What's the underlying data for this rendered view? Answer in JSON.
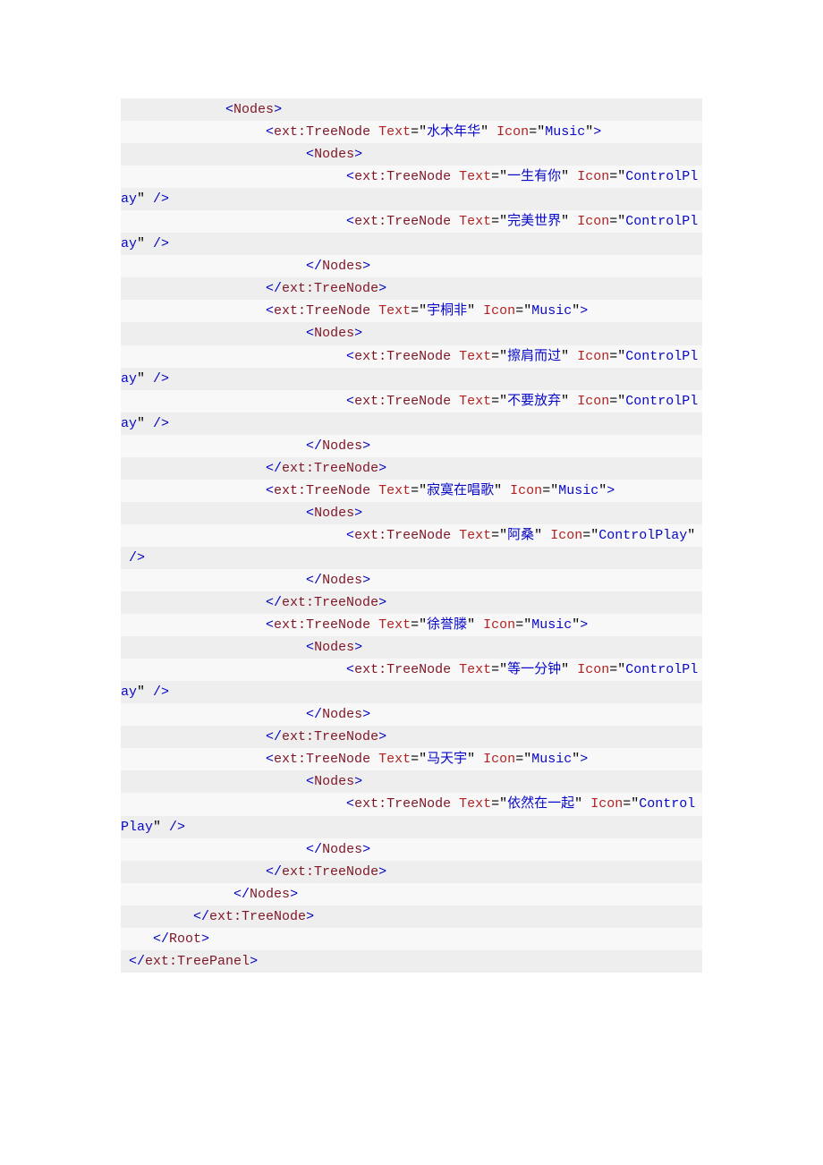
{
  "code": {
    "indent_unit": "    ",
    "tags": {
      "nodes": "Nodes",
      "treenode": "ext:TreeNode",
      "root": "Root",
      "treepanel": "ext:TreePanel"
    },
    "attrs": {
      "text": "Text",
      "icon": "Icon"
    },
    "icon_values": {
      "music": "Music",
      "controlplay": "ControlPlay",
      "controlpl": "ControlPl",
      "control": "Control"
    },
    "wrap_suffixes": {
      "ay_close": "ay\" />",
      "Play_close": "Play\" />",
      "space_close": " />"
    },
    "artists": {
      "a0": "水木年华",
      "a1": "宇桐非",
      "a2": "寂寞在唱歌",
      "a3": "徐誉滕",
      "a4": "马天宇"
    },
    "songs": {
      "s0": "一生有你",
      "s1": "完美世界",
      "s2": "擦肩而过",
      "s3": "不要放弃",
      "s4": "阿桑",
      "s5": "等一分钟",
      "s6": "依然在一起"
    }
  }
}
